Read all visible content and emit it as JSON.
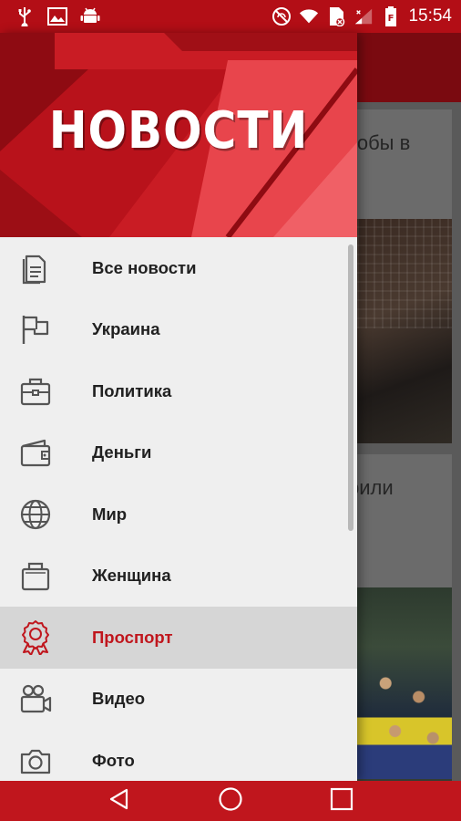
{
  "status_bar": {
    "time": "15:54",
    "left_icons": [
      "usb-icon",
      "image-icon",
      "android-icon"
    ],
    "right_icons": [
      "no-disturb-icon",
      "wifi-icon",
      "sim-icon",
      "signal-icon",
      "battery-icon"
    ]
  },
  "drawer": {
    "logo": "НОВОСТИ",
    "menu": [
      {
        "label": "Все новости",
        "icon": "document-icon"
      },
      {
        "label": "Украина",
        "icon": "flag-icon"
      },
      {
        "label": "Политика",
        "icon": "briefcase-icon"
      },
      {
        "label": "Деньги",
        "icon": "wallet-icon"
      },
      {
        "label": "Мир",
        "icon": "globe-icon"
      },
      {
        "label": "Женщина",
        "icon": "bag-icon"
      },
      {
        "label": "Проспорт",
        "icon": "award-icon",
        "active": true
      },
      {
        "label": "Видео",
        "icon": "video-camera-icon"
      },
      {
        "label": "Фото",
        "icon": "camera-icon"
      }
    ]
  },
  "background_feed": {
    "card1_text": "тобы в",
    "card2_text": "рили"
  },
  "colors": {
    "primary": "#c0161d",
    "dark_primary": "#b30e16",
    "active_label": "#c0161d",
    "drawer_bg": "#efefef",
    "active_bg": "#d6d6d6"
  },
  "nav_bar": {
    "buttons": [
      "back-icon",
      "home-icon",
      "recents-icon"
    ]
  }
}
